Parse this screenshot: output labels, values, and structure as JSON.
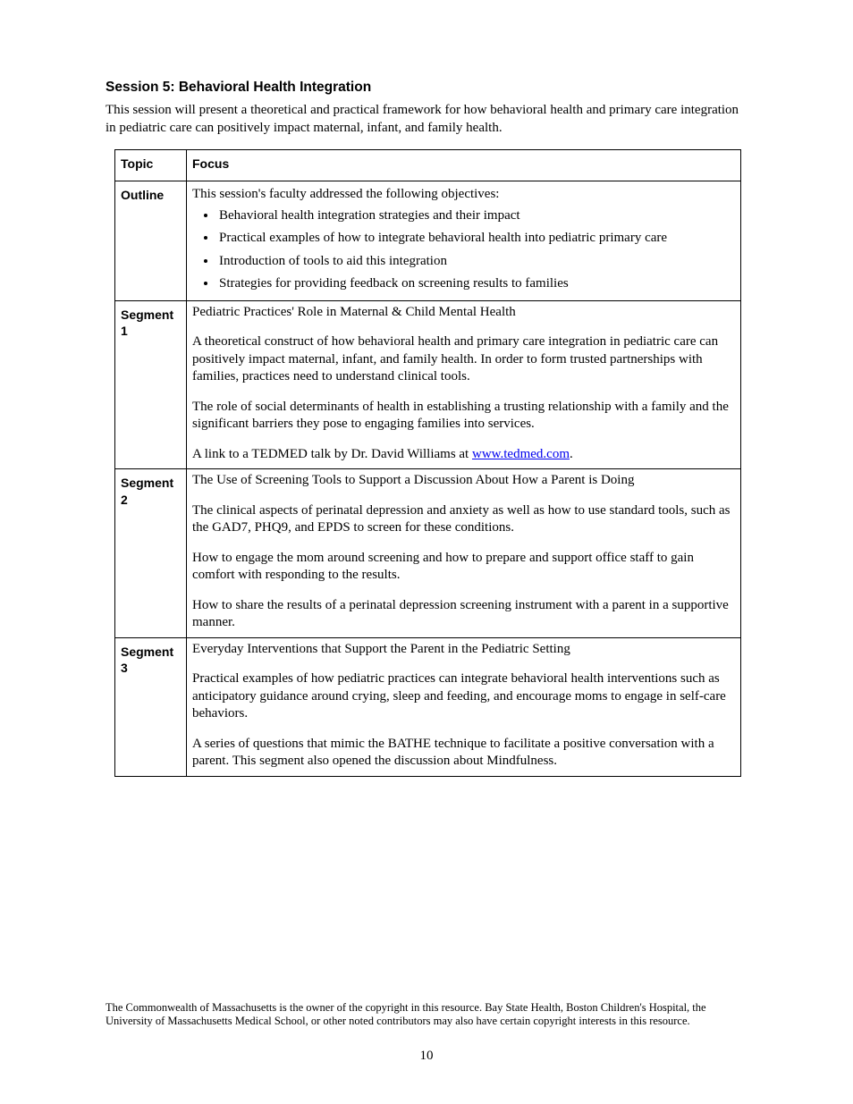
{
  "title": "Session 5: Behavioral Health Integration",
  "intro": "This session will present a theoretical and practical framework for how behavioral health and primary care integration in pediatric care can positively impact maternal, infant, and family health.",
  "table": {
    "headers": {
      "topic": "Topic",
      "focus": "Focus"
    },
    "rows": [
      {
        "label": "Outline",
        "lead": "This session's faculty addressed the following objectives:",
        "bullets": [
          "Behavioral health integration strategies and their impact",
          "Practical examples of how to integrate behavioral health into pediatric primary care",
          "Introduction of tools to aid this integration",
          "Strategies for providing feedback on screening results to families"
        ]
      },
      {
        "label": "Segment 1",
        "paras": [
          "Pediatric Practices' Role in Maternal & Child Mental Health",
          "A theoretical construct of how behavioral health and primary care integration in pediatric care can positively impact maternal, infant, and family health.  In order to form trusted partnerships with families, practices need to understand clinical tools.",
          "The role of social determinants of health in establishing a trusting relationship with a family and the significant barriers they pose to engaging families into services.",
          {
            "pre": "A link to a TEDMED talk by Dr. David Williams at ",
            "link_text": "www.tedmed.com",
            "post": "."
          }
        ]
      },
      {
        "label": "Segment 2",
        "paras": [
          "The Use of Screening Tools to Support a Discussion About How a Parent is Doing",
          "The clinical aspects of perinatal depression and anxiety as well as how to use standard tools, such as the GAD7, PHQ9, and EPDS to screen for these conditions.",
          "How to engage the mom around screening and how to prepare and support office staff to gain comfort with responding to the results.",
          "How to share the results of a perinatal depression screening instrument with a parent in a supportive manner."
        ]
      },
      {
        "label": "Segment 3",
        "paras": [
          "Everyday Interventions that Support the Parent in the Pediatric Setting",
          "Practical examples of how pediatric practices can integrate behavioral health interventions such as anticipatory guidance around crying, sleep and feeding, and encourage moms to engage in self-care behaviors.",
          "A series of questions that mimic the BATHE technique to facilitate a positive conversation with a parent.  This segment also opened the discussion about Mindfulness."
        ]
      }
    ]
  },
  "footnote": "The Commonwealth of Massachusetts is the owner of the copyright in this resource.  Bay State Health, Boston Children's Hospital, the University of Massachusetts Medical School, or other noted contributors may also have certain copyright interests in this resource.",
  "page_number": "10"
}
